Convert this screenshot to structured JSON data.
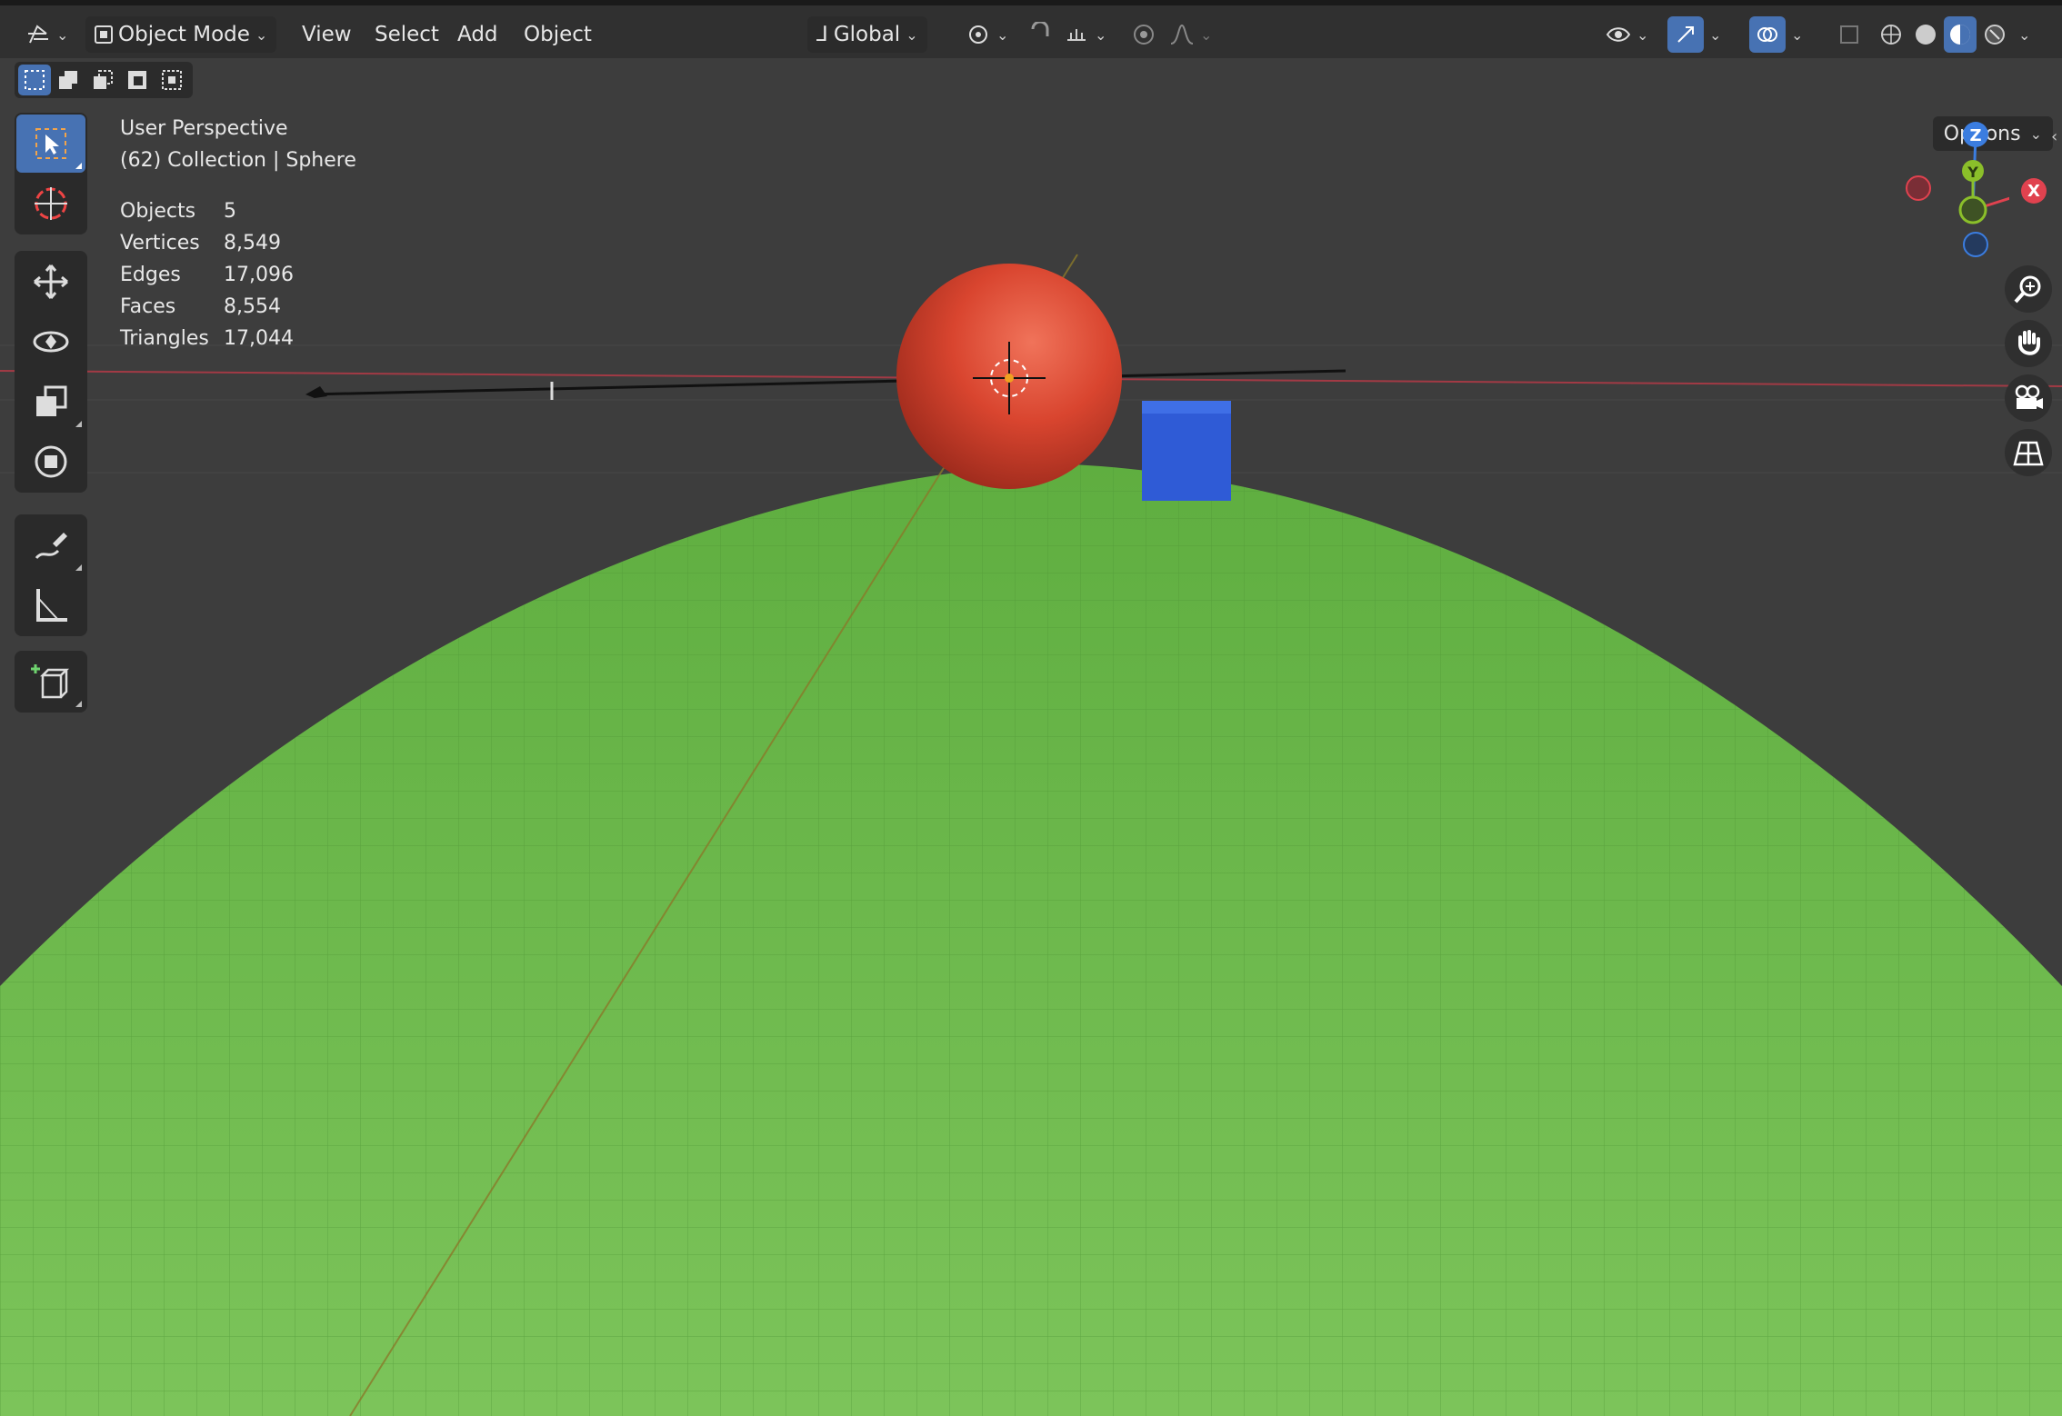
{
  "header": {
    "mode_label": "Object Mode",
    "menus": [
      "View",
      "Select",
      "Add",
      "Object"
    ],
    "orientation_label": "Global",
    "options_label": "Options"
  },
  "overlay_info": {
    "view_name": "User Perspective",
    "context": "(62) Collection | Sphere",
    "stats": [
      {
        "label": "Objects",
        "value": "5"
      },
      {
        "label": "Vertices",
        "value": "8,549"
      },
      {
        "label": "Edges",
        "value": "17,096"
      },
      {
        "label": "Faces",
        "value": "8,554"
      },
      {
        "label": "Triangles",
        "value": "17,044"
      }
    ]
  },
  "gizmo": {
    "z": "Z",
    "y": "Y",
    "x": "X"
  },
  "colors": {
    "accent": "#4772b3",
    "ground": "#6fbf4f",
    "sphere": "#d9452f",
    "cube": "#2f5bd6",
    "x_axis": "#e0424f",
    "y_axis": "#8bbf2a",
    "z_axis": "#3b7de0"
  },
  "tools": [
    "select-box-tool",
    "cursor-tool",
    "move-tool",
    "rotate-tool",
    "scale-tool",
    "transform-tool",
    "annotate-tool",
    "measure-tool",
    "add-cube-tool"
  ]
}
